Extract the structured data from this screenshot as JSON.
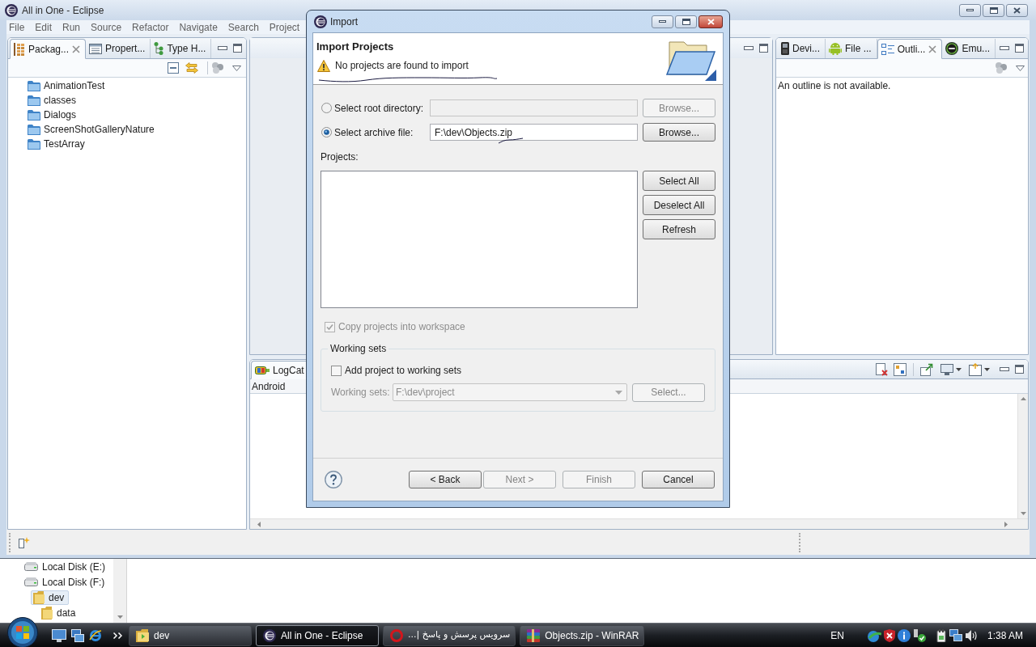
{
  "window": {
    "title": "All in One - Eclipse"
  },
  "menu": [
    "File",
    "Edit",
    "Run",
    "Source",
    "Refactor",
    "Navigate",
    "Search",
    "Project"
  ],
  "package_view": {
    "tabs": [
      {
        "label": "Packag...",
        "kind": "packages",
        "selected": true
      },
      {
        "label": "Propert...",
        "kind": "properties",
        "selected": false
      },
      {
        "label": "Type H...",
        "kind": "hierarchy",
        "selected": false
      }
    ],
    "tree": [
      {
        "label": "AnimationTest"
      },
      {
        "label": "classes"
      },
      {
        "label": "Dialogs"
      },
      {
        "label": "ScreenShotGalleryNature"
      },
      {
        "label": "TestArray"
      }
    ]
  },
  "outline_view": {
    "tabs": [
      {
        "label": "Devi...",
        "kind": "devices",
        "selected": false
      },
      {
        "label": "File ...",
        "kind": "android",
        "selected": false
      },
      {
        "label": "Outli...",
        "kind": "outline",
        "selected": true
      },
      {
        "label": "Emu...",
        "kind": "emulator",
        "selected": false
      }
    ],
    "message": "An outline is not available."
  },
  "logcat_view": {
    "tabs": [
      {
        "label": "LogCat",
        "kind": "logcat",
        "selected": true
      }
    ],
    "header": "Android"
  },
  "dialog": {
    "title": "Import",
    "heading": "Import Projects",
    "message": "No projects are found to import",
    "sources": [
      {
        "label": "Select root directory:",
        "selected": false,
        "disabled": true,
        "button": "Browse..."
      },
      {
        "label": "Select archive file:",
        "selected": true,
        "disabled": false,
        "value": "F:\\dev\\Objects.zip",
        "button": "Browse..."
      }
    ],
    "projects_label": "Projects:",
    "project_buttons": [
      "Select All",
      "Deselect All",
      "Refresh"
    ],
    "copy_option": {
      "label": "Copy projects into workspace",
      "checked": true,
      "disabled": true
    },
    "working_sets": {
      "title": "Working sets",
      "add_option": {
        "label": "Add project to working sets",
        "checked": false
      },
      "field_label": "Working sets:",
      "value": "F:\\dev\\project",
      "button": "Select...",
      "disabled": true
    },
    "buttons": [
      {
        "label": "< Back",
        "disabled": false
      },
      {
        "label": "Next >",
        "disabled": true
      },
      {
        "label": "Finish",
        "disabled": true
      },
      {
        "label": "Cancel",
        "disabled": false
      }
    ]
  },
  "explorer": {
    "tree": [
      {
        "label": "Local Disk (E:)",
        "kind": "drive",
        "selected": false
      },
      {
        "label": "Local Disk (F:)",
        "kind": "drive",
        "selected": false,
        "children": [
          {
            "label": "dev",
            "kind": "folder",
            "selected": true,
            "children": [
              {
                "label": "data",
                "kind": "folder",
                "selected": false
              }
            ]
          }
        ]
      }
    ]
  },
  "taskbar": {
    "tasks": [
      {
        "label": "dev",
        "kind": "explorer",
        "selected": false
      },
      {
        "label": "All in One - Eclipse",
        "kind": "eclipse",
        "selected": true
      },
      {
        "label": "سرویس پرسش و پاسخ |...",
        "kind": "browser",
        "selected": false
      },
      {
        "label": "Objects.zip - WinRAR",
        "kind": "archive",
        "selected": false
      }
    ],
    "language": "EN",
    "clock": "1:38 AM"
  }
}
